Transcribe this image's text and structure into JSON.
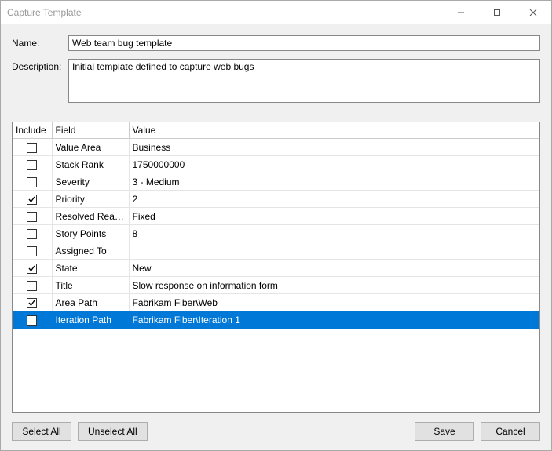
{
  "window": {
    "title": "Capture Template"
  },
  "labels": {
    "name": "Name:",
    "description": "Description:"
  },
  "fields": {
    "name": "Web team bug template",
    "description": "Initial template defined to capture web bugs"
  },
  "grid": {
    "headers": {
      "include": "Include",
      "field": "Field",
      "value": "Value"
    },
    "rows": [
      {
        "include": false,
        "field": "Value Area",
        "value": "Business",
        "selected": false
      },
      {
        "include": false,
        "field": "Stack Rank",
        "value": "1750000000",
        "selected": false
      },
      {
        "include": false,
        "field": "Severity",
        "value": "3 - Medium",
        "selected": false
      },
      {
        "include": true,
        "field": "Priority",
        "value": "2",
        "selected": false
      },
      {
        "include": false,
        "field": "Resolved Reason",
        "value": "Fixed",
        "selected": false
      },
      {
        "include": false,
        "field": "Story Points",
        "value": "8",
        "selected": false
      },
      {
        "include": false,
        "field": "Assigned To",
        "value": "",
        "selected": false
      },
      {
        "include": true,
        "field": "State",
        "value": "New",
        "selected": false
      },
      {
        "include": false,
        "field": "Title",
        "value": "Slow response on information form",
        "selected": false
      },
      {
        "include": true,
        "field": "Area Path",
        "value": "Fabrikam Fiber\\Web",
        "selected": false
      },
      {
        "include": false,
        "field": "Iteration Path",
        "value": "Fabrikam Fiber\\Iteration 1",
        "selected": true
      }
    ]
  },
  "buttons": {
    "select_all": "Select All",
    "unselect_all": "Unselect All",
    "save": "Save",
    "cancel": "Cancel"
  }
}
